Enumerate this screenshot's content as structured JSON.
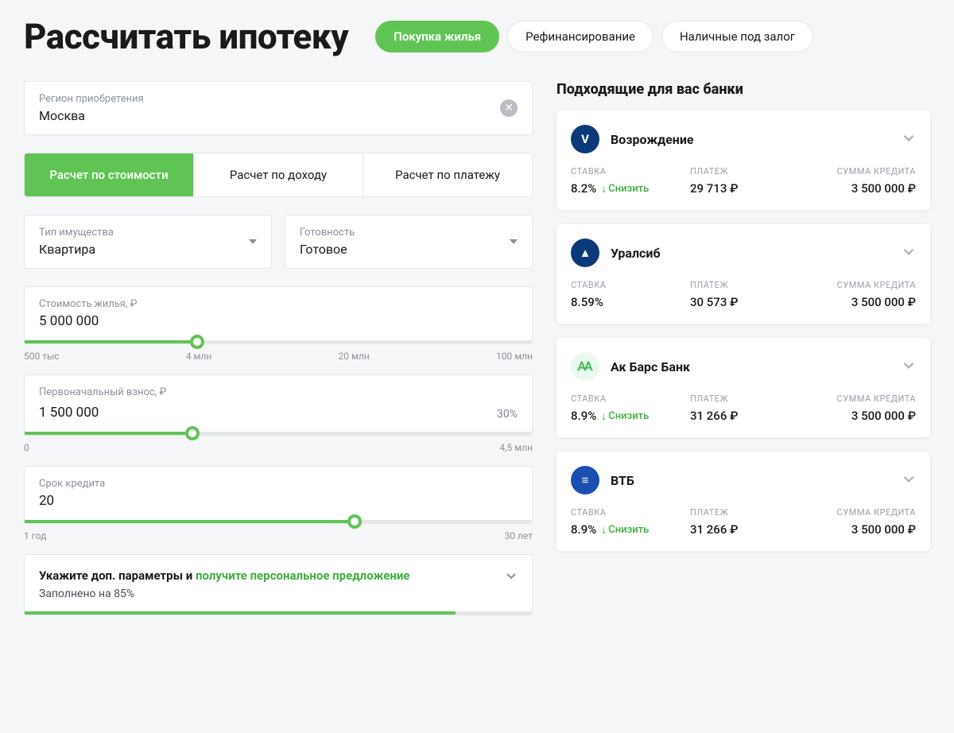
{
  "header": {
    "title": "Рассчитать ипотеку",
    "pills": [
      "Покупка жилья",
      "Рефинансирование",
      "Наличные под залог"
    ],
    "activePill": 0
  },
  "region": {
    "label": "Регион приобретения",
    "value": "Москва"
  },
  "calcTabs": {
    "options": [
      "Расчет по стоимости",
      "Расчет по доходу",
      "Расчет по платежу"
    ],
    "active": 0
  },
  "selects": {
    "propertyType": {
      "label": "Тип имущества",
      "value": "Квартира"
    },
    "readiness": {
      "label": "Готовность",
      "value": "Готовое"
    }
  },
  "sliders": {
    "price": {
      "label": "Стоимость жилья, ₽",
      "value": "5 000 000",
      "fillPct": 34,
      "ticks": [
        "500 тыс",
        "4 млн",
        "20 млн",
        "100 млн"
      ]
    },
    "down": {
      "label": "Первоначальный взнос, ₽",
      "value": "1 500 000",
      "pct": "30%",
      "fillPct": 33,
      "ticks": [
        "0",
        "4,5 млн"
      ]
    },
    "term": {
      "label": "Срок кредита",
      "value": "20",
      "fillPct": 65,
      "ticks": [
        "1 год",
        "30 лет"
      ]
    }
  },
  "extra": {
    "title1": "Укажите доп. параметры и ",
    "title2": "получите персональное предложение",
    "sub": "Заполнено на 85%",
    "fillPct": 85
  },
  "right": {
    "title": "Подходящие для вас банки",
    "stats_labels": {
      "rate": "СТАВКА",
      "payment": "ПЛАТЕЖ",
      "sum": "СУММА КРЕДИТА"
    },
    "lower_text": "Снизить",
    "banks": [
      {
        "name": "Возрождение",
        "logoBg": "#0c3a78",
        "logoText": "V",
        "rate": "8.2%",
        "canLower": true,
        "payment": "29 713 ₽",
        "sum": "3 500 000 ₽"
      },
      {
        "name": "Уралсиб",
        "logoBg": "#0c3a78",
        "logoText": "▲",
        "rate": "8.59%",
        "canLower": false,
        "payment": "30 573 ₽",
        "sum": "3 500 000 ₽"
      },
      {
        "name": "Ак Барс Банк",
        "logoBg": "#e9f9ee",
        "logoText": "Ꜳ",
        "logoColor": "#41b651",
        "rate": "8.9%",
        "canLower": true,
        "payment": "31 266 ₽",
        "sum": "3 500 000 ₽"
      },
      {
        "name": "ВТБ",
        "logoBg": "#1a4fb0",
        "logoText": "≡",
        "rate": "8.9%",
        "canLower": true,
        "payment": "31 266 ₽",
        "sum": "3 500 000 ₽"
      }
    ]
  }
}
